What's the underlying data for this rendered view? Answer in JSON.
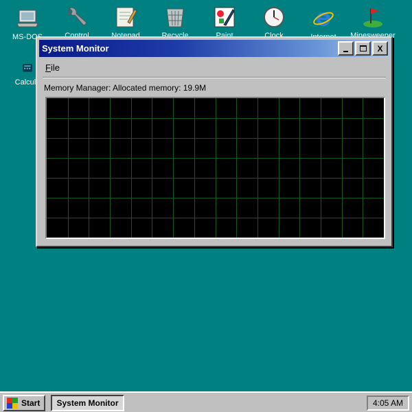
{
  "desktop": {
    "icons": [
      {
        "label": "MS-DOS",
        "icon": "computer-icon"
      },
      {
        "label": "Control",
        "icon": "wrench-icon"
      },
      {
        "label": "Notepad",
        "icon": "notepad-icon"
      },
      {
        "label": "Recycle",
        "icon": "recycle-bin-icon"
      },
      {
        "label": "Paint",
        "icon": "paint-icon"
      },
      {
        "label": "Clock",
        "icon": "clock-icon"
      },
      {
        "label": "Internet",
        "icon": "internet-explorer-icon"
      },
      {
        "label": "Minesweeper",
        "icon": "minesweeper-flag-icon"
      },
      {
        "label": "Calcula",
        "icon": "calculator-icon"
      }
    ]
  },
  "window": {
    "title": "System Monitor",
    "buttons": {
      "minimize": "_",
      "maximize": "□",
      "close": "X"
    },
    "menu": {
      "file_underlined": "F",
      "file_rest": "ile"
    },
    "status": "Memory Manager: Allocated memory: 19.9M",
    "graph": {
      "background": "#000000",
      "grid_color": "#0f5a1f",
      "columns": 16,
      "rows": 7
    }
  },
  "taskbar": {
    "start_label": "Start",
    "task_label": "System Monitor",
    "clock": "4:05 AM"
  },
  "colors": {
    "desktop": "#008080",
    "titlebar_start": "#0a1a8a",
    "titlebar_end": "#a8c8ef"
  }
}
